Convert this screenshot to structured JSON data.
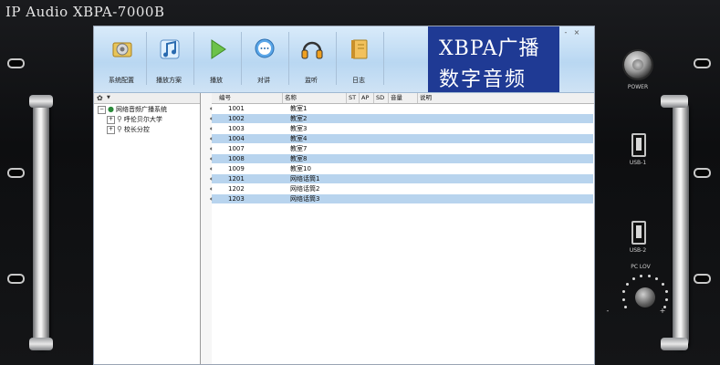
{
  "device": {
    "brand": "IP Audio  XBPA-7000B",
    "power_label": "POWER",
    "usb1_label": "USB-1",
    "usb2_label": "USB-2",
    "pc_lov_label": "PC LOV",
    "minus": "-",
    "plus": "+"
  },
  "toolbar": {
    "items": [
      {
        "label": "系统配置",
        "icon": "gear-icon"
      },
      {
        "label": "播放方案",
        "icon": "music-note-icon"
      },
      {
        "label": "播放",
        "icon": "play-icon"
      },
      {
        "label": "对讲",
        "icon": "chat-bubble-icon"
      },
      {
        "label": "监听",
        "icon": "headphones-icon"
      },
      {
        "label": "日志",
        "icon": "log-book-icon"
      }
    ],
    "promo_line1": "XBPA广播",
    "promo_line2": "数字音频",
    "window_controls": [
      "-",
      "×"
    ]
  },
  "tree": {
    "root": "网络音频广播系统",
    "children": [
      "呼伦贝尔大学",
      "校长分控"
    ]
  },
  "table": {
    "columns": [
      "编号",
      "名称",
      "ST",
      "AP",
      "SD",
      "音量",
      "说明"
    ],
    "rows": [
      {
        "no": "1001",
        "name": "教室1"
      },
      {
        "no": "1002",
        "name": "教室2"
      },
      {
        "no": "1003",
        "name": "教室3"
      },
      {
        "no": "1004",
        "name": "教室4"
      },
      {
        "no": "1007",
        "name": "教室7"
      },
      {
        "no": "1008",
        "name": "教室8"
      },
      {
        "no": "1009",
        "name": "教室10"
      },
      {
        "no": "1201",
        "name": "网络话筒1"
      },
      {
        "no": "1202",
        "name": "网络话筒2"
      },
      {
        "no": "1203",
        "name": "网络话筒3"
      }
    ]
  },
  "colors": {
    "promo_bg": "#1f3a94",
    "row_highlight": "#b8d4ee",
    "toolbar_bg": "#c9e0f5"
  }
}
